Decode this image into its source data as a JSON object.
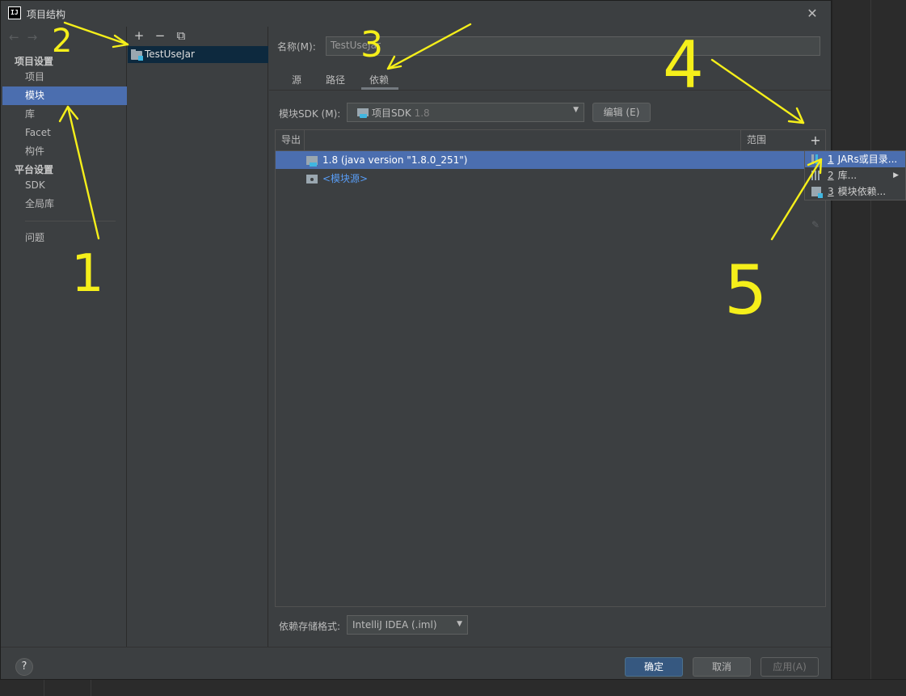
{
  "window": {
    "title": "项目结构",
    "app_icon_text": "IJ",
    "close_glyph": "✕"
  },
  "nav": {
    "back_glyph": "←",
    "forward_glyph": "→",
    "section_project": "项目设置",
    "items_project": [
      "项目",
      "模块",
      "库",
      "Facet",
      "构件"
    ],
    "section_platform": "平台设置",
    "items_platform": [
      "SDK",
      "全局库"
    ],
    "problems": "问题",
    "selected": "模块"
  },
  "modules": {
    "toolbar": {
      "add": "+",
      "remove": "−",
      "copy": "⧉"
    },
    "items": [
      "TestUseJar"
    ]
  },
  "module_settings": {
    "name_label": "名称(M):",
    "name_value": "TestUseJar",
    "tabs": [
      "源",
      "路径",
      "依赖"
    ],
    "active_tab": "依赖",
    "sdk_label": "模块SDK (M):",
    "sdk_value": "项目SDK",
    "sdk_version": "1.8",
    "edit_button": "编辑 (E)",
    "table": {
      "headers": [
        "导出",
        "",
        "范围"
      ],
      "rows": [
        {
          "label": "1.8 (java version \"1.8.0_251\")",
          "selected": true
        },
        {
          "label": "<模块源>",
          "selected": false
        }
      ]
    },
    "side_toolbar": {
      "add": "+",
      "edit": "✎"
    },
    "add_menu": [
      {
        "num": "1",
        "label": "JARs或目录...",
        "icon": "jar-icon",
        "highlighted": true
      },
      {
        "num": "2",
        "label": "库...",
        "icon": "library-icon",
        "submenu": true
      },
      {
        "num": "3",
        "label": "模块依赖...",
        "icon": "module-icon"
      }
    ],
    "format_label": "依赖存储格式:",
    "format_value": "IntelliJ IDEA (.iml)"
  },
  "footer": {
    "help": "?",
    "ok": "确定",
    "cancel": "取消",
    "apply": "应用(A)"
  },
  "annotations": {
    "marks": [
      "1",
      "2",
      "3",
      "4",
      "5"
    ],
    "color": "#f5ef1a"
  },
  "colors": {
    "selection": "#4b6eaf",
    "background": "#3c3f41",
    "link": "#589df6",
    "primary_button": "#365880"
  }
}
